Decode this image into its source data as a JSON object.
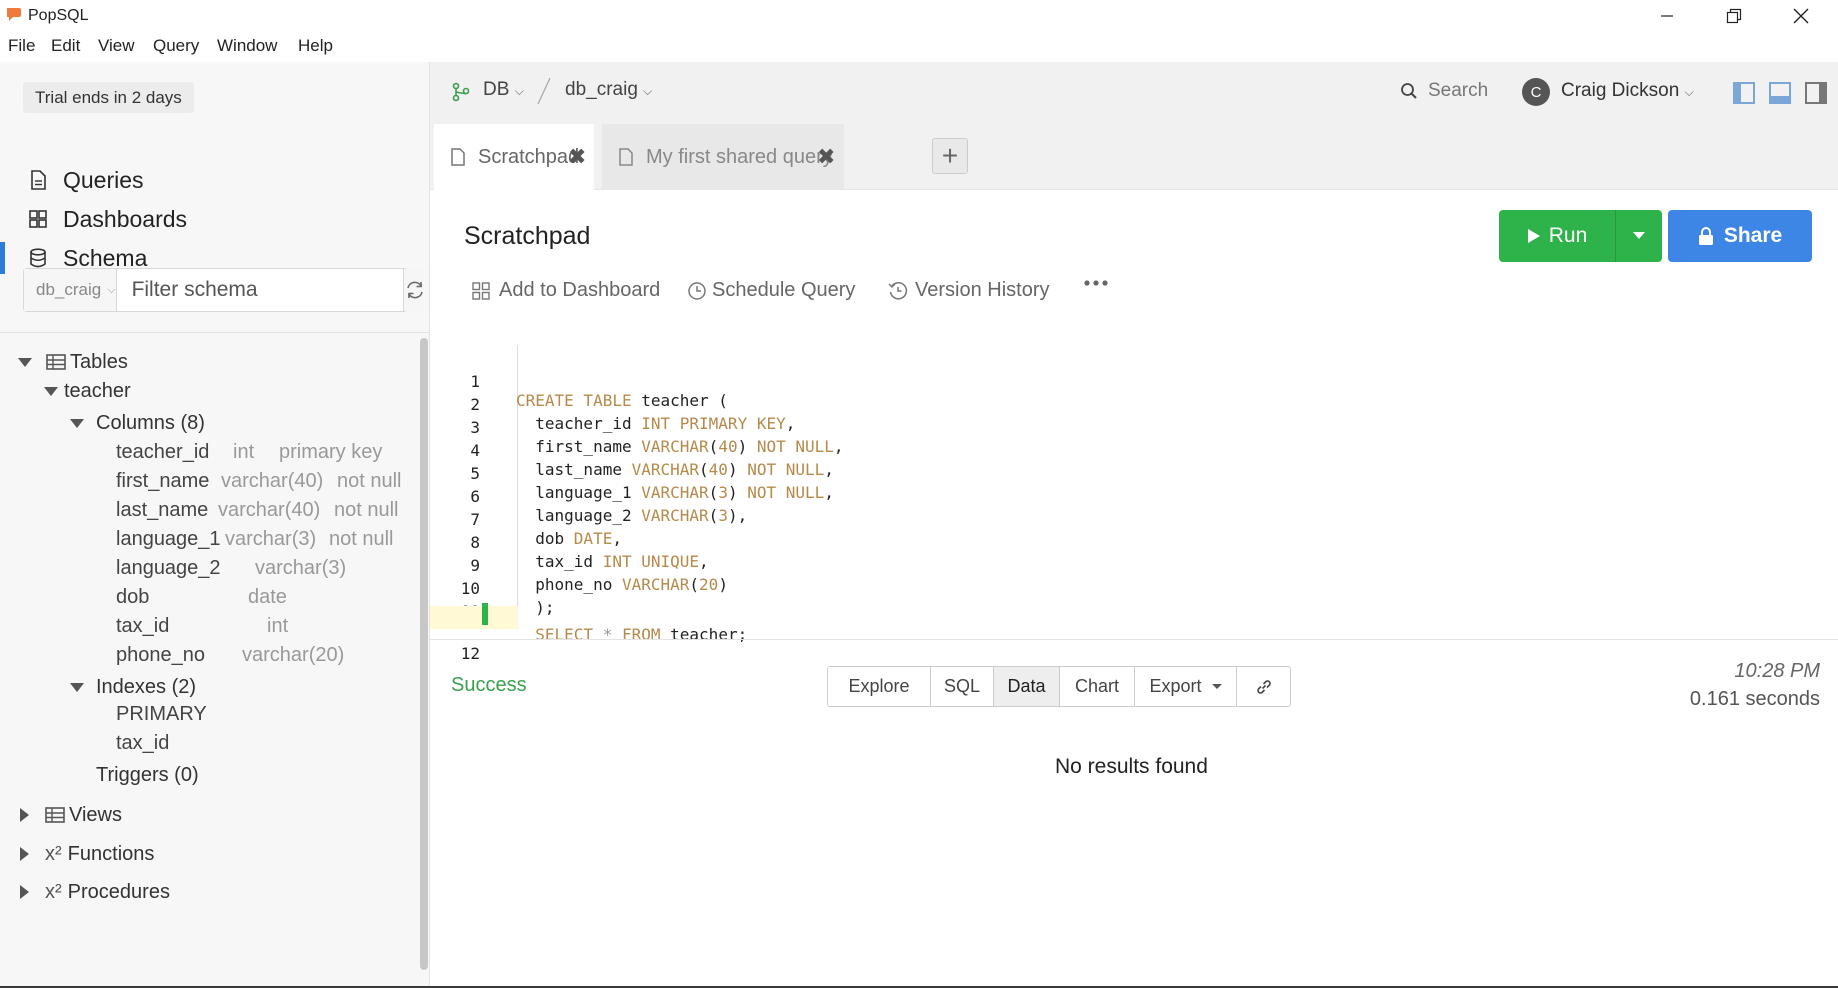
{
  "app": {
    "title": "PopSQL"
  },
  "menu": [
    "File",
    "Edit",
    "View",
    "Query",
    "Window",
    "Help"
  ],
  "sidebar": {
    "trial_text": "Trial ends in 2 days",
    "nav": [
      {
        "label": "Queries",
        "icon": "document-icon"
      },
      {
        "label": "Dashboards",
        "icon": "grid-icon"
      },
      {
        "label": "Schema",
        "icon": "database-icon",
        "active": true
      }
    ],
    "db_select": "db_craig",
    "filter_placeholder": "Filter schema",
    "tree": {
      "tables_label": "Tables",
      "table_name": "teacher",
      "columns_label": "Columns (8)",
      "columns": [
        {
          "name": "teacher_id",
          "type": "int",
          "extra": "primary key"
        },
        {
          "name": "first_name",
          "type": "varchar(40)",
          "extra": "not null"
        },
        {
          "name": "last_name",
          "type": "varchar(40)",
          "extra": "not null"
        },
        {
          "name": "language_1",
          "type": "varchar(3)",
          "extra": "not null"
        },
        {
          "name": "language_2",
          "type": "varchar(3)",
          "extra": ""
        },
        {
          "name": "dob",
          "type": "date",
          "extra": ""
        },
        {
          "name": "tax_id",
          "type": "int",
          "extra": ""
        },
        {
          "name": "phone_no",
          "type": "varchar(20)",
          "extra": ""
        }
      ],
      "indexes_label": "Indexes (2)",
      "indexes": [
        "PRIMARY",
        "tax_id"
      ],
      "triggers_label": "Triggers (0)",
      "views_label": "Views",
      "functions_label": "Functions",
      "procedures_label": "Procedures",
      "fx_symbol": "x²"
    }
  },
  "topbar": {
    "db_label": "DB",
    "db_name": "db_craig",
    "search_label": "Search",
    "user_initial": "C",
    "user_name": "Craig Dickson"
  },
  "tabs": [
    {
      "label": "Scratchpad",
      "active": true
    },
    {
      "label": "My first shared query",
      "active": false
    }
  ],
  "query": {
    "title": "Scratchpad",
    "run_label": "Run",
    "share_label": "Share",
    "actions": [
      "Add to Dashboard",
      "Schedule Query",
      "Version History"
    ]
  },
  "code_lines": [
    "1",
    "2",
    "3",
    "4",
    "5",
    "6",
    "7",
    "8",
    "9",
    "10",
    "11",
    "12"
  ],
  "results": {
    "status": "Success",
    "tabs": [
      "Explore",
      "SQL",
      "Data",
      "Chart",
      "Export"
    ],
    "active_tab": "Data",
    "time": "10:28 PM",
    "duration": "0.161 seconds",
    "message": "No results found"
  },
  "colors": {
    "accent": "#2b7cdd",
    "run_green": "#2eb34a",
    "share_blue": "#3d86e6",
    "success": "#3aa04e",
    "keyword": "#b58a4a"
  }
}
